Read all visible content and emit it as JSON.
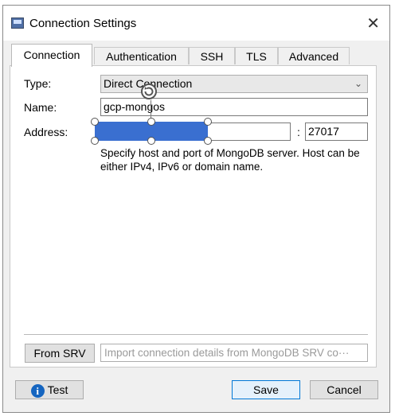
{
  "window": {
    "title": "Connection Settings",
    "close_glyph": "✕"
  },
  "tabs": [
    "Connection",
    "Authentication",
    "SSH",
    "TLS",
    "Advanced"
  ],
  "active_tab": "Connection",
  "form": {
    "type_label": "Type:",
    "type_value": "Direct Connection",
    "name_label": "Name:",
    "name_value": "gcp-mongos",
    "address_label": "Address:",
    "host_value": "",
    "port_sep": ":",
    "port_value": "27017",
    "help_text": "Specify host and port of MongoDB server. Host can be either IPv4, IPv6 or domain name."
  },
  "srv": {
    "button_label": "From SRV",
    "input_placeholder": "Import connection details from MongoDB SRV co···"
  },
  "footer": {
    "test_label": "Test",
    "save_label": "Save",
    "cancel_label": "Cancel"
  },
  "colors": {
    "selection": "#3a6fd0",
    "primary_border": "#0078d7",
    "info_icon": "#1565c0"
  },
  "icons": [
    "app-window-icon",
    "close-icon",
    "chevron-down-icon",
    "rotate-handle-icon",
    "info-icon"
  ]
}
